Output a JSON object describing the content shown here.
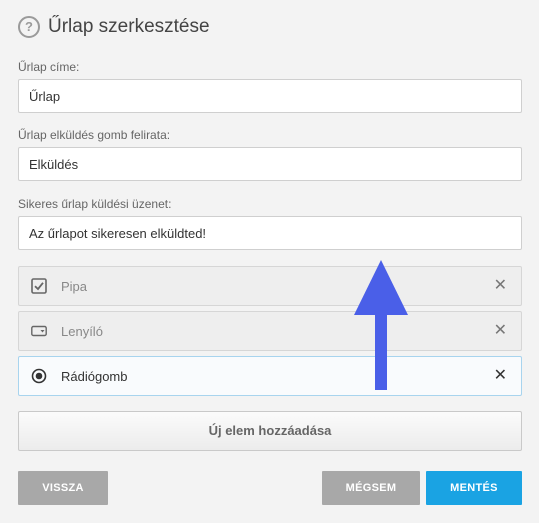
{
  "header": {
    "help_icon": "help-circle-icon",
    "title": "Űrlap szerkesztése"
  },
  "fields": {
    "form_title": {
      "label": "Űrlap címe:",
      "value": "Űrlap"
    },
    "submit_label": {
      "label": "Űrlap elküldés gomb felirata:",
      "value": "Elküldés"
    },
    "success_message": {
      "label": "Sikeres űrlap küldési üzenet:",
      "value": "Az űrlapot sikeresen elküldted!"
    }
  },
  "elements": [
    {
      "label": "Pipa",
      "icon": "checkbox-icon",
      "remove": "✕"
    },
    {
      "label": "Lenyíló",
      "icon": "dropdown-icon",
      "remove": "✕"
    },
    {
      "label": "Rádiógomb",
      "icon": "radio-icon",
      "remove": "✕"
    }
  ],
  "actions": {
    "add_element": "Új elem hozzáadása",
    "back": "VISSZA",
    "cancel": "MÉGSEM",
    "save": "MENTÉS"
  },
  "colors": {
    "accent": "#1aa3e3",
    "arrow": "#4a5fe8",
    "button_grey": "#a8a8a8"
  }
}
